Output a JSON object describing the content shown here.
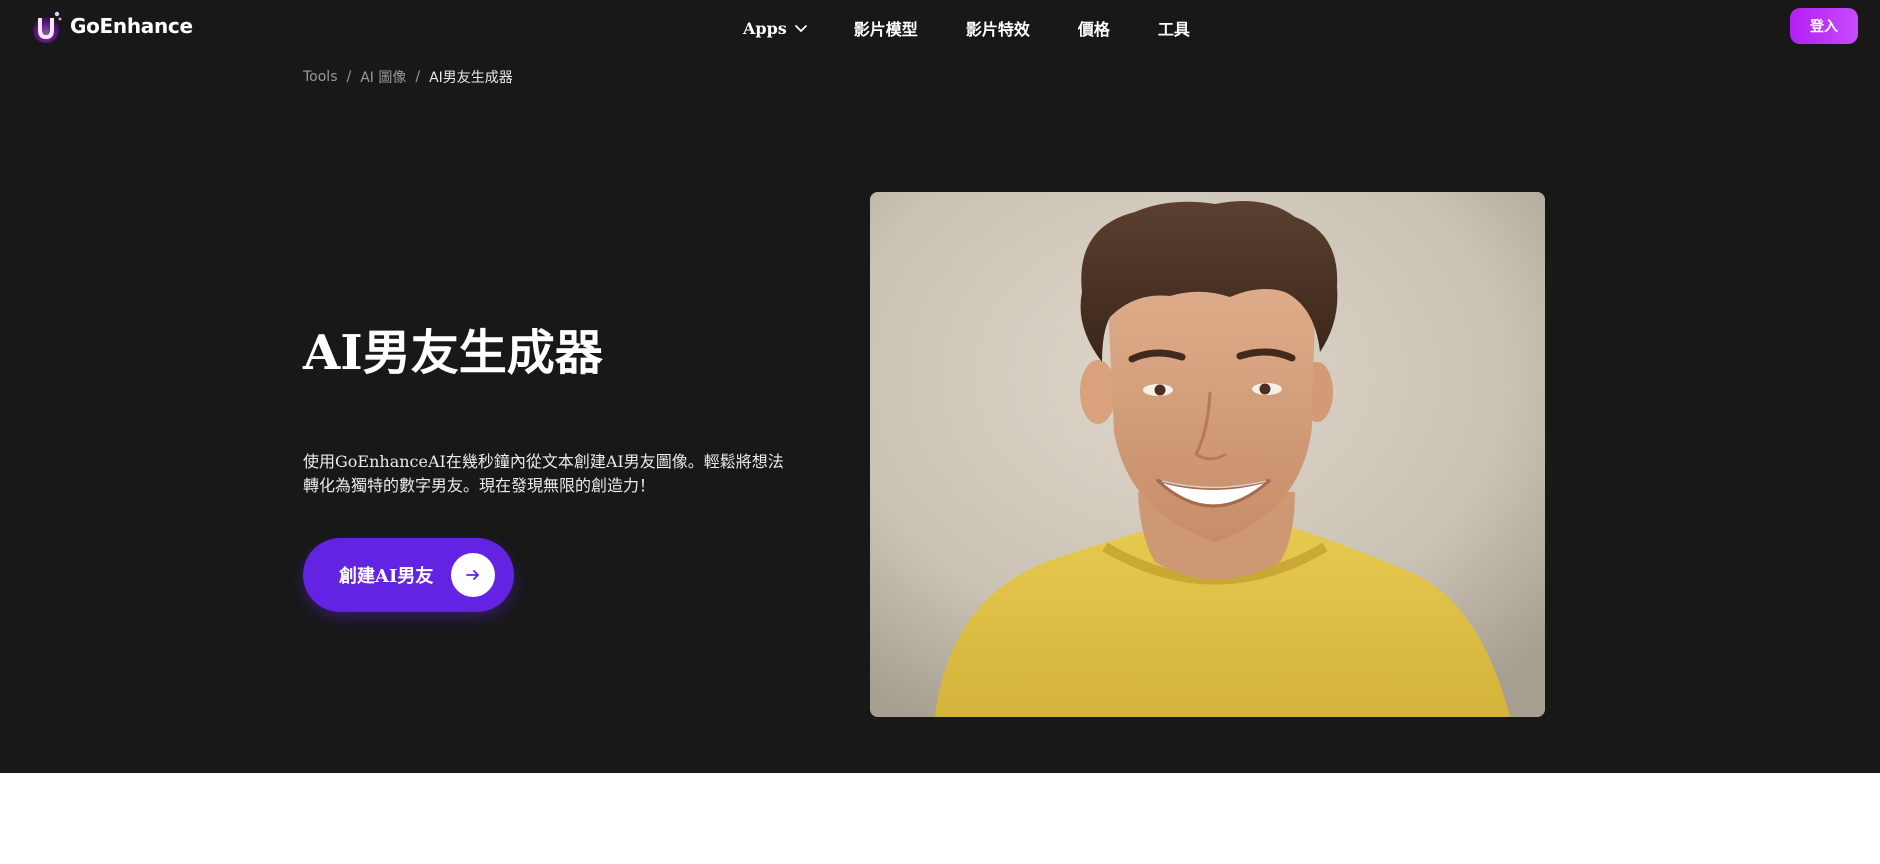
{
  "header": {
    "logo_text": "GoEnhance",
    "nav": [
      {
        "label": "Apps",
        "has_dropdown": true
      },
      {
        "label": "影片模型"
      },
      {
        "label": "影片特效"
      },
      {
        "label": "價格"
      },
      {
        "label": "工具"
      }
    ],
    "login_label": "登入"
  },
  "breadcrumb": {
    "items": [
      "Tools",
      "AI 圖像",
      "AI男友生成器"
    ],
    "separator": "/"
  },
  "hero": {
    "title": "AI男友生成器",
    "description": "使用GoEnhanceAI在幾秒鐘內從文本創建AI男友圖像。輕鬆將想法轉化為獨特的數字男友。現在發現無限的創造力！",
    "cta_label": "創建AI男友",
    "image": {
      "icon": "portrait-photo"
    }
  },
  "colors": {
    "background": "#181818",
    "cta": "#6323e3",
    "login_gradient_start": "#b31ff3",
    "login_gradient_end": "#c84bff",
    "logo_accent": "#a020f0"
  }
}
